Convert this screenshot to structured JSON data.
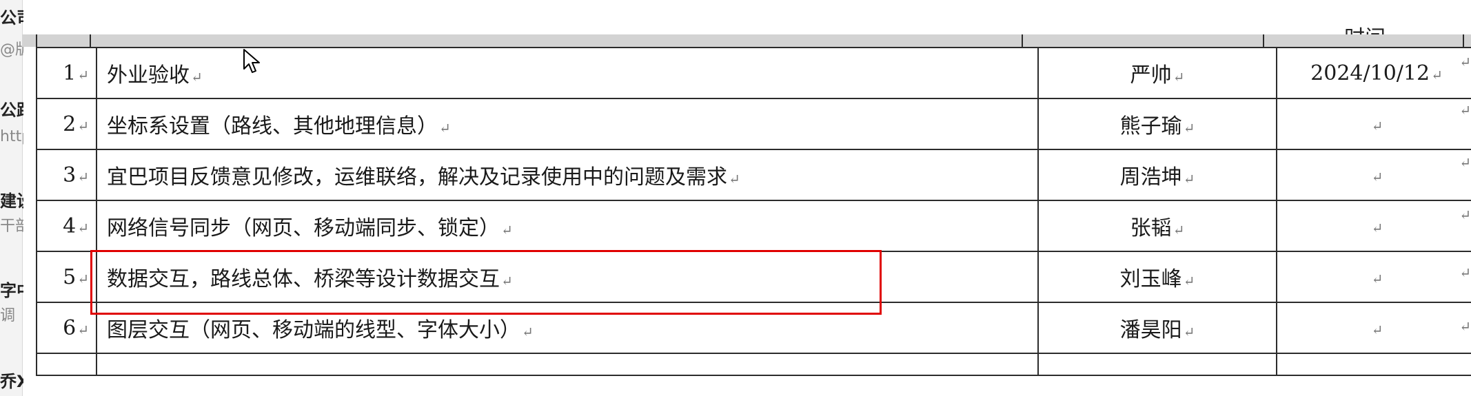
{
  "sidebar_fragments": [
    {
      "text": "公司",
      "style": "bold"
    },
    {
      "text": "@版",
      "style": "sub"
    },
    {
      "text": "公路",
      "style": "bold"
    },
    {
      "text": "http",
      "style": "sub"
    },
    {
      "text": "建设",
      "style": "bold"
    },
    {
      "text": "干部",
      "style": "sub"
    },
    {
      "text": "字中",
      "style": "bold"
    },
    {
      "text": "调",
      "style": "sub"
    },
    {
      "text": "乔X",
      "style": "bold"
    }
  ],
  "header_partial": "时间",
  "paragraph_mark": "↵",
  "table": {
    "rows": [
      {
        "num": "1",
        "task": "外业验收",
        "person": "严帅",
        "time": "2024/10/12"
      },
      {
        "num": "2",
        "task": "坐标系设置（路线、其他地理信息）",
        "person": "熊子瑜",
        "time": ""
      },
      {
        "num": "3",
        "task": "宜巴项目反馈意见修改，运维联络，解决及记录使用中的问题及需求",
        "person": "周浩坤",
        "time": ""
      },
      {
        "num": "4",
        "task": "网络信号同步（网页、移动端同步、锁定）",
        "person": "张韬",
        "time": ""
      },
      {
        "num": "5",
        "task": "数据交互，路线总体、桥梁等设计数据交互",
        "person": "刘玉峰",
        "time": ""
      },
      {
        "num": "6",
        "task": "图层交互（网页、移动端的线型、字体大小）",
        "person": "潘昊阳",
        "time": ""
      }
    ]
  },
  "highlight_color": "#e00000"
}
